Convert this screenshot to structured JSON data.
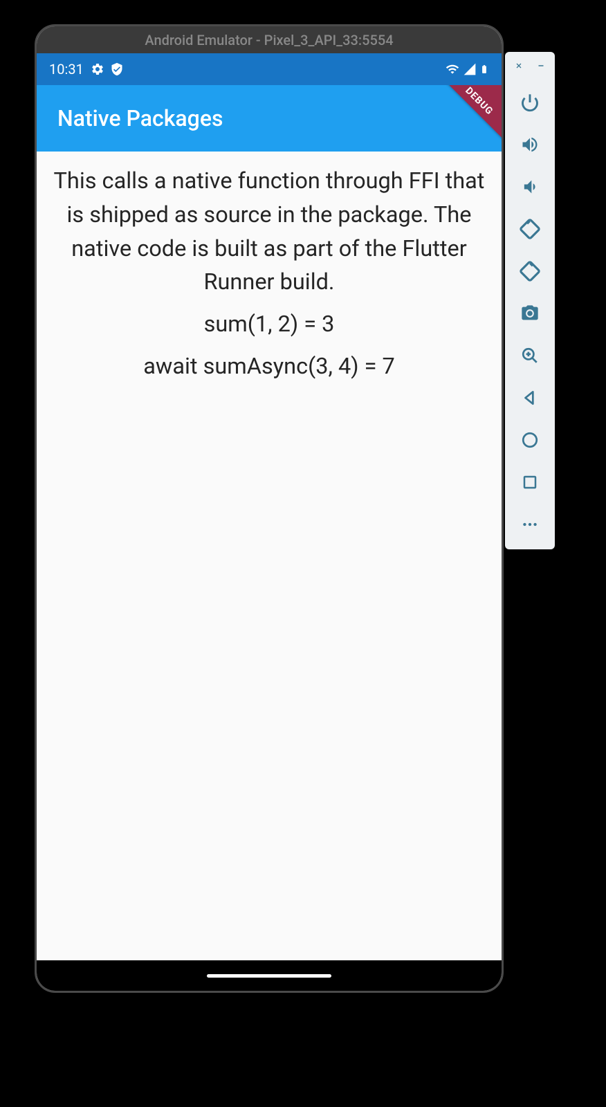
{
  "emulator": {
    "title": "Android Emulator - Pixel_3_API_33:5554",
    "sidebar": {
      "close": "close",
      "minimize": "minimize",
      "power": "power",
      "volumeUp": "volume up",
      "volumeDown": "volume down",
      "rotateLeft": "rotate left",
      "rotateRight": "rotate right",
      "screenshot": "screenshot",
      "zoom": "zoom",
      "back": "back",
      "home": "home",
      "overview": "overview",
      "more": "more options"
    }
  },
  "statusbar": {
    "time": "10:31"
  },
  "app": {
    "title": "Native Packages",
    "debugBanner": "DEBUG",
    "description": "This calls a native function through FFI that is shipped as source in the package. The native code is built as part of the Flutter Runner build.",
    "result1": "sum(1, 2) = 3",
    "result2": "await sumAsync(3, 4) = 7"
  }
}
